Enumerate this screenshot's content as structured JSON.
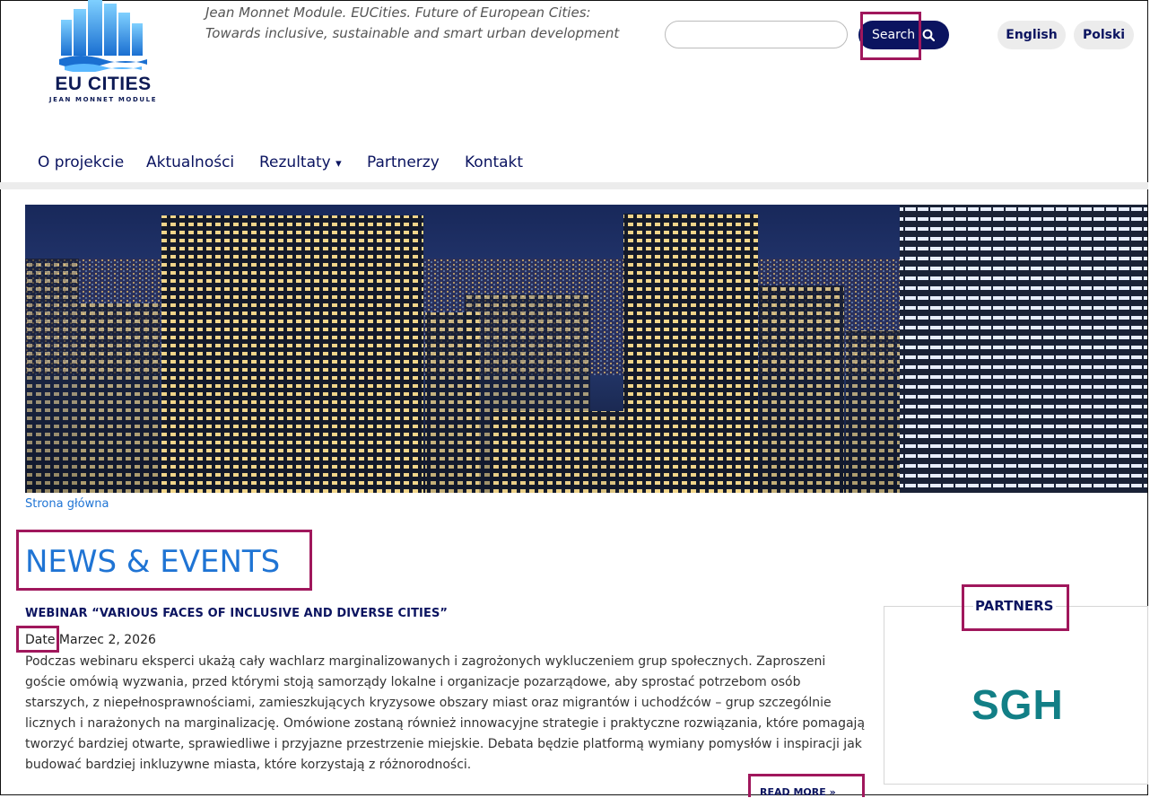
{
  "header": {
    "logo_title": "EU CITIES",
    "logo_subtitle": "JEAN MONNET MODULE",
    "tagline": "Jean Monnet Module. EUCities. Future of European Cities: Towards inclusive, sustainable and smart urban development",
    "search_placeholder": "",
    "search_button": "Search",
    "languages": [
      "English",
      "Polski"
    ]
  },
  "nav": {
    "items": [
      "O projekcie",
      "Aktualności",
      "Rezultaty",
      "Partnerzy",
      "Kontakt"
    ],
    "active": "Aktualności",
    "dropdown_caret": "▾"
  },
  "breadcrumb": "Strona główna",
  "main": {
    "page_title": "NEWS & EVENTS",
    "article": {
      "title": "WEBINAR “VARIOUS FACES OF INCLUSIVE AND DIVERSE CITIES”",
      "date_label": "Date",
      "date_value": "Marzec 2, 2026",
      "body": "Podczas webinaru eksperci ukażą cały wachlarz marginalizowanych i zagrożonych wykluczeniem grup społecznych. Zaproszeni goście omówią wyzwania, przed którymi stoją samorządy lokalne i organizacje pozarządowe, aby sprostać potrzebom osób starszych, z niepełnosprawnościami, zamieszkujących kryzysowe obszary miast oraz migrantów i uchodźców – grup szczególnie licznych i narażonych na marginalizację. Omówione zostaną również innowacyjne strategie i praktyczne rozwiązania, które pomagają tworzyć bardziej otwarte, sprawiedliwe i przyjazne przestrzenie miejskie. Debata będzie platformą wymiany pomysłów i inspiracji jak budować bardziej inkluzywne miasta, które korzystają z różnorodności.",
      "read_more": "READ MORE »"
    }
  },
  "sidebar": {
    "partners_title": "PARTNERS",
    "partner_logo_text": "SGH"
  },
  "colors": {
    "navy": "#0b1460",
    "accent_blue": "#1f74d4",
    "highlight": "#a0175c",
    "sgh_teal": "#127f86"
  }
}
